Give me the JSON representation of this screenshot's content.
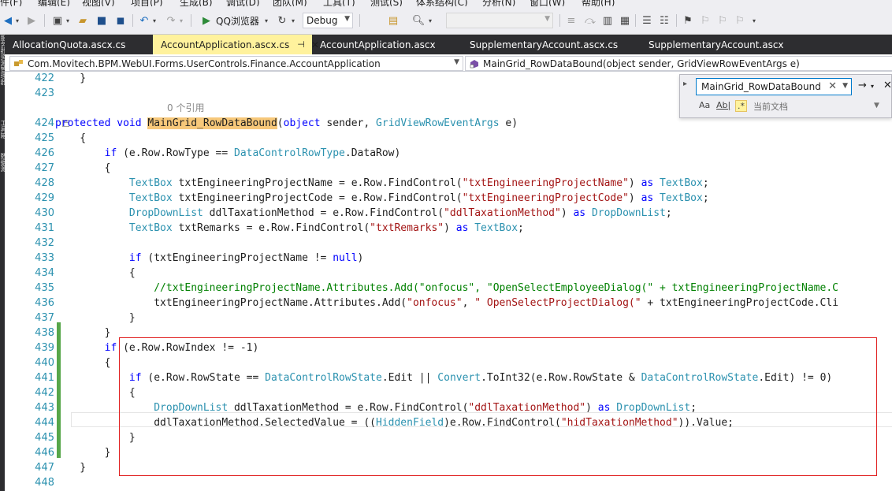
{
  "menu": {
    "items": [
      "件(F)",
      "编辑(E)",
      "视图(V)",
      "项目(P)",
      "生成(B)",
      "调试(D)",
      "团队(M)",
      "工具(T)",
      "测试(S)",
      "体系结构(C)",
      "分析(N)",
      "窗口(W)",
      "帮助(H)"
    ]
  },
  "toolbar": {
    "browser_label": "QQ浏览器",
    "config_value": "Debug",
    "platform_value": ""
  },
  "left_strip": {
    "labels": [
      "服务器资源管理器",
      "工具箱",
      "数据源"
    ]
  },
  "tabs": [
    {
      "label": "AllocationQuota.ascx.cs",
      "active": false
    },
    {
      "label": "AccountApplication.ascx.cs",
      "active": true,
      "pin": "⊣",
      "close": "✕"
    },
    {
      "label": "AccountApplication.ascx",
      "active": false
    },
    {
      "label": "SupplementaryAccount.ascx.cs",
      "active": false
    },
    {
      "label": "SupplementaryAccount.ascx",
      "active": false
    }
  ],
  "navbar": {
    "class_value": "Com.Movitech.BPM.WebUI.Forms.UserControls.Finance.AccountApplication",
    "member_value": "MainGrid_RowDataBound(object sender, GridViewRowEventArgs e)"
  },
  "find": {
    "query": "MainGrid_RowDataBound",
    "scope": "当前文档",
    "opt_case": "Aa",
    "opt_word": "Ab|",
    "opt_regex": ".*"
  },
  "editor": {
    "lines": [
      {
        "n": "422",
        "parts": [
          [
            "pl",
            "    }"
          ]
        ]
      },
      {
        "n": "423",
        "parts": [
          [
            "pl",
            ""
          ]
        ]
      },
      {
        "n": "",
        "ref": "0 个引用"
      },
      {
        "n": "424",
        "fold": "−",
        "parts": [
          [
            "kw",
            "protected"
          ],
          [
            "pl",
            " "
          ],
          [
            "kw",
            "void"
          ],
          [
            "pl",
            " "
          ],
          [
            "hl",
            "MainGrid_RowDataBound"
          ],
          [
            "pl",
            "("
          ],
          [
            "kw",
            "object"
          ],
          [
            "pl",
            " sender, "
          ],
          [
            "ty",
            "GridViewRowEventArgs"
          ],
          [
            "pl",
            " e)"
          ]
        ]
      },
      {
        "n": "425",
        "parts": [
          [
            "pl",
            "    {"
          ]
        ]
      },
      {
        "n": "426",
        "parts": [
          [
            "pl",
            "        "
          ],
          [
            "kw",
            "if"
          ],
          [
            "pl",
            " (e.Row.RowType == "
          ],
          [
            "ty",
            "DataControlRowType"
          ],
          [
            "pl",
            ".DataRow)"
          ]
        ]
      },
      {
        "n": "427",
        "parts": [
          [
            "pl",
            "        {"
          ]
        ]
      },
      {
        "n": "428",
        "parts": [
          [
            "pl",
            "            "
          ],
          [
            "ty",
            "TextBox"
          ],
          [
            "pl",
            " txtEngineeringProjectName = e.Row.FindControl("
          ],
          [
            "st",
            "\"txtEngineeringProjectName\""
          ],
          [
            "pl",
            ") "
          ],
          [
            "kw",
            "as"
          ],
          [
            "pl",
            " "
          ],
          [
            "ty",
            "TextBox"
          ],
          [
            "pl",
            ";"
          ]
        ]
      },
      {
        "n": "429",
        "parts": [
          [
            "pl",
            "            "
          ],
          [
            "ty",
            "TextBox"
          ],
          [
            "pl",
            " txtEngineeringProjectCode = e.Row.FindControl("
          ],
          [
            "st",
            "\"txtEngineeringProjectCode\""
          ],
          [
            "pl",
            ") "
          ],
          [
            "kw",
            "as"
          ],
          [
            "pl",
            " "
          ],
          [
            "ty",
            "TextBox"
          ],
          [
            "pl",
            ";"
          ]
        ]
      },
      {
        "n": "430",
        "parts": [
          [
            "pl",
            "            "
          ],
          [
            "ty",
            "DropDownList"
          ],
          [
            "pl",
            " ddlTaxationMethod = e.Row.FindControl("
          ],
          [
            "st",
            "\"ddlTaxationMethod\""
          ],
          [
            "pl",
            ") "
          ],
          [
            "kw",
            "as"
          ],
          [
            "pl",
            " "
          ],
          [
            "ty",
            "DropDownList"
          ],
          [
            "pl",
            ";"
          ]
        ]
      },
      {
        "n": "431",
        "parts": [
          [
            "pl",
            "            "
          ],
          [
            "ty",
            "TextBox"
          ],
          [
            "pl",
            " txtRemarks = e.Row.FindControl("
          ],
          [
            "st",
            "\"txtRemarks\""
          ],
          [
            "pl",
            ") "
          ],
          [
            "kw",
            "as"
          ],
          [
            "pl",
            " "
          ],
          [
            "ty",
            "TextBox"
          ],
          [
            "pl",
            ";"
          ]
        ]
      },
      {
        "n": "432",
        "parts": [
          [
            "pl",
            ""
          ]
        ]
      },
      {
        "n": "433",
        "parts": [
          [
            "pl",
            "            "
          ],
          [
            "kw",
            "if"
          ],
          [
            "pl",
            " (txtEngineeringProjectName != "
          ],
          [
            "kw",
            "null"
          ],
          [
            "pl",
            ")"
          ]
        ]
      },
      {
        "n": "434",
        "parts": [
          [
            "pl",
            "            {"
          ]
        ]
      },
      {
        "n": "435",
        "parts": [
          [
            "pl",
            "                "
          ],
          [
            "cm",
            "//txtEngineeringProjectName.Attributes.Add(\"onfocus\", \"OpenSelectEmployeeDialog(\" + txtEngineeringProjectName.C"
          ]
        ]
      },
      {
        "n": "436",
        "parts": [
          [
            "pl",
            "                txtEngineeringProjectName.Attributes.Add("
          ],
          [
            "st",
            "\"onfocus\""
          ],
          [
            "pl",
            ", "
          ],
          [
            "st",
            "\" OpenSelectProjectDialog(\""
          ],
          [
            "pl",
            " + txtEngineeringProjectCode.Cli"
          ]
        ]
      },
      {
        "n": "437",
        "parts": [
          [
            "pl",
            "            }"
          ]
        ]
      },
      {
        "n": "438",
        "parts": [
          [
            "pl",
            "        }"
          ]
        ]
      },
      {
        "n": "439",
        "parts": [
          [
            "pl",
            "        "
          ],
          [
            "kw",
            "if"
          ],
          [
            "pl",
            " (e.Row.RowIndex != -1)"
          ]
        ]
      },
      {
        "n": "440",
        "parts": [
          [
            "pl",
            "        {"
          ]
        ]
      },
      {
        "n": "441",
        "parts": [
          [
            "pl",
            "            "
          ],
          [
            "kw",
            "if"
          ],
          [
            "pl",
            " (e.Row.RowState == "
          ],
          [
            "ty",
            "DataControlRowState"
          ],
          [
            "pl",
            ".Edit || "
          ],
          [
            "ty",
            "Convert"
          ],
          [
            "pl",
            ".ToInt32(e.Row.RowState & "
          ],
          [
            "ty",
            "DataControlRowState"
          ],
          [
            "pl",
            ".Edit) != 0)"
          ]
        ]
      },
      {
        "n": "442",
        "parts": [
          [
            "pl",
            "            {"
          ]
        ]
      },
      {
        "n": "443",
        "parts": [
          [
            "pl",
            "                "
          ],
          [
            "ty",
            "DropDownList"
          ],
          [
            "pl",
            " ddlTaxationMethod = e.Row.FindControl("
          ],
          [
            "st",
            "\"ddlTaxationMethod\""
          ],
          [
            "pl",
            ") "
          ],
          [
            "kw",
            "as"
          ],
          [
            "pl",
            " "
          ],
          [
            "ty",
            "DropDownList"
          ],
          [
            "pl",
            ";"
          ]
        ]
      },
      {
        "n": "444",
        "parts": [
          [
            "pl",
            "                ddlTaxationMethod.SelectedValue = (("
          ],
          [
            "ty",
            "HiddenField"
          ],
          [
            "pl",
            ")e.Row.FindControl("
          ],
          [
            "st",
            "\"hidTaxationMethod\""
          ],
          [
            "pl",
            ")).Value;"
          ]
        ]
      },
      {
        "n": "445",
        "parts": [
          [
            "pl",
            "            }"
          ]
        ]
      },
      {
        "n": "446",
        "parts": [
          [
            "pl",
            "        }"
          ]
        ]
      },
      {
        "n": "447",
        "parts": [
          [
            "pl",
            "    }"
          ]
        ]
      },
      {
        "n": "448",
        "parts": [
          [
            "pl",
            ""
          ]
        ]
      },
      {
        "n": "",
        "ref": "0 个引用"
      }
    ]
  }
}
